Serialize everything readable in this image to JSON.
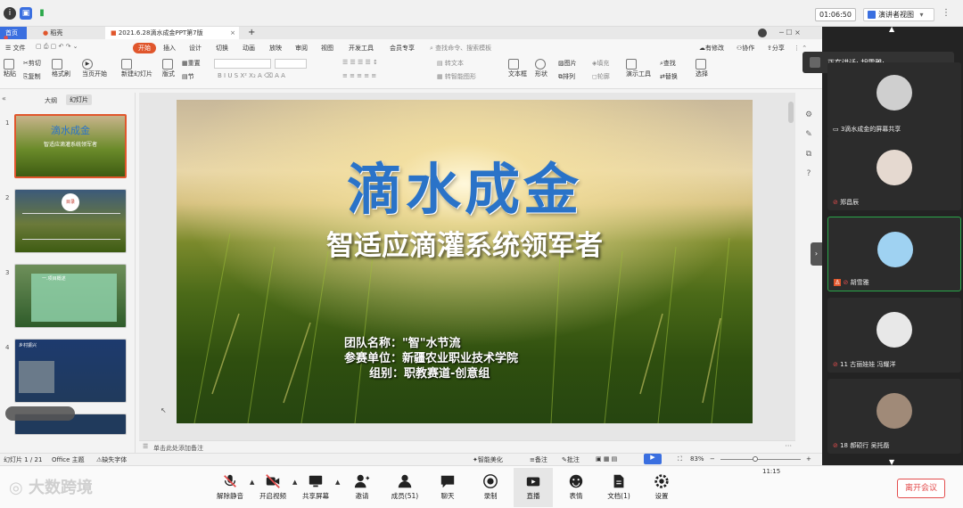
{
  "meeting": {
    "timer": "01:06:50",
    "view_label": "演讲者视图",
    "speaking_label": "正在讲话: 胡雪雅;",
    "leave_label": "离开会议"
  },
  "colors": {
    "accent": "#3a6fe0",
    "wps_orange": "#e0562c",
    "leave_red": "#e34d4d",
    "tab_orange": "#ff6a00"
  },
  "wps": {
    "tabs": [
      {
        "label": "首页"
      },
      {
        "label": "稻壳"
      },
      {
        "label": "2021.6.28滴水成金PPT第7版"
      }
    ],
    "file_menu": "文件",
    "menus": [
      "开始",
      "插入",
      "设计",
      "切换",
      "动画",
      "放映",
      "审阅",
      "视图",
      "开发工具",
      "会员专享"
    ],
    "search_placeholder": "查找命令、搜索模板",
    "right_actions": [
      "有修改",
      "协作",
      "分享"
    ],
    "toolbar": {
      "paste": "粘贴",
      "cut": "剪切",
      "copy": "复制",
      "format_painter": "格式刷",
      "play_from_current": "当页开始",
      "new_slide": "新建幻灯片",
      "layout": "版式",
      "section": "节",
      "reset": "重置",
      "text_box": "文本框",
      "shape": "形状",
      "arrange": "排列",
      "picture": "图片",
      "fill": "填充",
      "outline": "轮廓",
      "present_tools": "演示工具",
      "find": "查找",
      "replace": "替换",
      "select": "选择",
      "convert_text": "转文本",
      "smart_graphic": "转智能图形"
    },
    "panel_tabs": [
      "大纲",
      "幻灯片"
    ],
    "slide_count_status": "幻灯片 1 / 21",
    "theme_status": "Office 主题",
    "missing_font": "缺失字体",
    "smart_beautify": "智能美化",
    "notes_label": "备注",
    "comments_label": "批注",
    "zoom": "83%",
    "notes_placeholder": "单击此处添加备注",
    "taskbar_time": "11:15"
  },
  "slide": {
    "title": "滴水成金",
    "subtitle": "智适应滴灌系统领军者",
    "team_line": "团队名称：\"智\"水节流",
    "unit_line": "参赛单位：新疆农业职业技术学院",
    "group_line": "组别：职教赛道-创意组"
  },
  "thumbs": [
    {
      "num": "1",
      "title": "滴水成金",
      "subtitle": "智适应滴灌系统领军者"
    },
    {
      "num": "2",
      "title": "目录"
    },
    {
      "num": "3",
      "title": "一.项目概述"
    },
    {
      "num": "4",
      "title": "乡村振兴"
    }
  ],
  "participants": [
    {
      "name": "3滴水成金的屏幕共享"
    },
    {
      "name": "郑昌辰"
    },
    {
      "name": "胡雪雅"
    },
    {
      "name": "11 古丽娃娃 冯耀洋"
    },
    {
      "name": "18 郝硕行 吴托磊"
    }
  ],
  "bottom": {
    "unmute": "解除静音",
    "video": "开启视频",
    "share": "共享屏幕",
    "invite": "邀请",
    "members": "成员(51)",
    "chat": "聊天",
    "record": "录制",
    "live": "直播",
    "emoji": "表情",
    "docs": "文档(1)",
    "settings": "设置"
  },
  "watermark": "大数跨境"
}
